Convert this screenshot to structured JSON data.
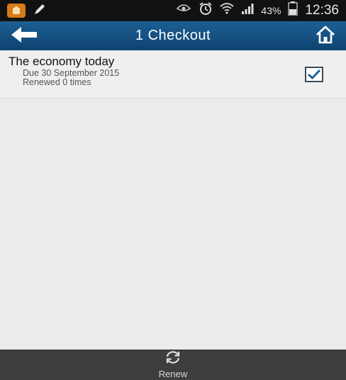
{
  "status_bar": {
    "battery_percent": "43%",
    "time": "12:36",
    "icons": [
      "notification-icon",
      "pencil-icon",
      "eye-icon",
      "alarm-icon",
      "wifi-icon",
      "signal-icon",
      "battery-icon"
    ]
  },
  "app_bar": {
    "title": "1 Checkout",
    "back_icon": "back-arrow-icon",
    "home_icon": "home-icon",
    "color": "#174f80"
  },
  "checkouts": [
    {
      "title": "The economy today",
      "due": "Due 30 September 2015",
      "renewed": "Renewed 0 times",
      "checked": true
    }
  ],
  "bottom_bar": {
    "renew_label": "Renew",
    "renew_icon": "refresh-icon"
  }
}
